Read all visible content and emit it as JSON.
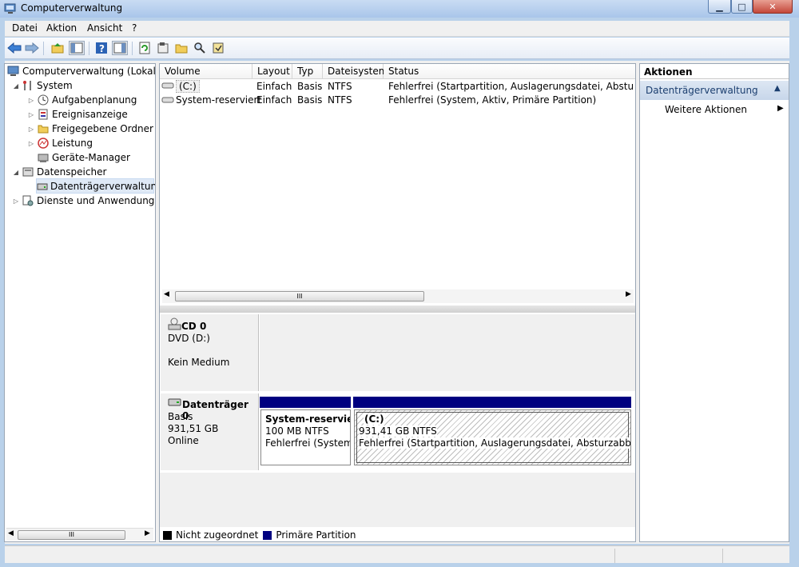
{
  "window": {
    "title": "Computerverwaltung",
    "minimize_glyph": "▁",
    "maximize_glyph": "□",
    "close_glyph": "✕"
  },
  "menu": [
    "Datei",
    "Aktion",
    "Ansicht",
    "?"
  ],
  "tree": {
    "root": "Computerverwaltung (Lokal)",
    "system": "System",
    "aufgabenplanung": "Aufgabenplanung",
    "ereignisanzeige": "Ereignisanzeige",
    "freigegebene_ordner": "Freigegebene Ordner",
    "leistung": "Leistung",
    "geraete_manager": "Geräte-Manager",
    "datenspeicher": "Datenspeicher",
    "datentraegerverwaltung": "Datenträgerverwaltung",
    "dienste": "Dienste und Anwendungen"
  },
  "volume_table": {
    "columns": [
      "Volume",
      "Layout",
      "Typ",
      "Dateisystem",
      "Status"
    ],
    "rows": [
      {
        "volume": "(C:)",
        "layout": "Einfach",
        "typ": "Basis",
        "dateisystem": "NTFS",
        "status": "Fehlerfrei (Startpartition, Auslagerungsdatei, Absturzabbild"
      },
      {
        "volume": "System-reserviert",
        "layout": "Einfach",
        "typ": "Basis",
        "dateisystem": "NTFS",
        "status": "Fehlerfrei (System, Aktiv, Primäre Partition)"
      }
    ]
  },
  "disks": {
    "cd": {
      "name": "CD 0",
      "type": "DVD (D:)",
      "state": "Kein Medium"
    },
    "disk0": {
      "name": "Datenträger 0",
      "type": "Basis",
      "size": "931,51 GB",
      "state": "Online",
      "partitions": [
        {
          "name": "System-reserviert",
          "size": "100 MB NTFS",
          "status": "Fehlerfrei (System, A"
        },
        {
          "name": "(C:)",
          "size": "931,41 GB NTFS",
          "status": "Fehlerfrei (Startpartition, Auslagerungsdatei, Absturzabbild, Prim"
        }
      ]
    }
  },
  "legend": {
    "unallocated": "Nicht zugeordnet",
    "primary": "Primäre Partition"
  },
  "actions": {
    "header": "Aktionen",
    "section": "Datenträgerverwaltung",
    "more": "Weitere Aktionen"
  },
  "scroll_thumb_glyph": "III",
  "colors": {
    "primary_partition": "#000080",
    "unallocated": "#000000",
    "selection": "#dfe9f6",
    "action_section": "#d4e0f0"
  }
}
